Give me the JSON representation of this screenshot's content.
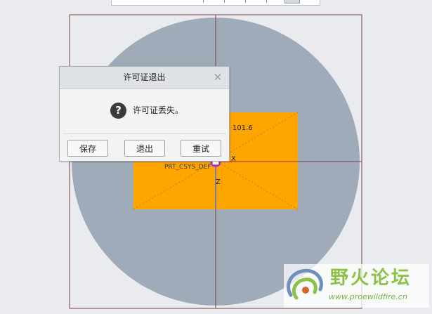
{
  "viewport": {
    "colors": {
      "background": "#e9ebee",
      "part_circle": "#a0abb9",
      "sketch_rectangle": "#ffa500",
      "frame_lines": "#7a3d48",
      "csys_marker": "#d233d2"
    },
    "dimension_label": "101.6",
    "csys_label": "PRT_CSYS_DEF",
    "axis_x_label": "X",
    "axis_z_label": "Z"
  },
  "dialog": {
    "title": "许可证退出",
    "close_icon": "close-icon",
    "message_icon": "question-icon",
    "message": "许可证丢失。",
    "buttons": {
      "save": "保存",
      "quit": "退出",
      "retry": "重试"
    }
  },
  "watermark": {
    "name": "野火论坛",
    "url": "www.proewildfire.cn"
  }
}
